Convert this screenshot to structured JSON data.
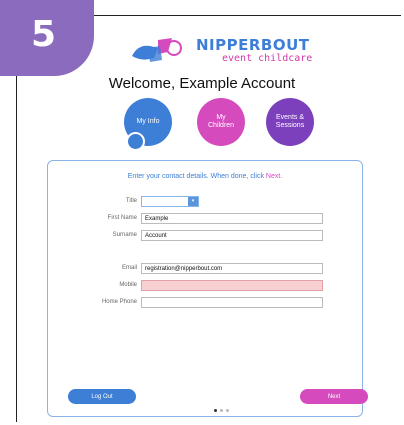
{
  "step_number": "5",
  "brand": {
    "name": "NIPPERBOUT",
    "tagline": "event childcare"
  },
  "welcome": "Welcome, Example Account",
  "nav": [
    {
      "label": "My Info"
    },
    {
      "label": "My Children"
    },
    {
      "label": "Events & Sessions"
    }
  ],
  "form": {
    "instruction_main": "Enter your contact details.  When done, click ",
    "instruction_next": "Next.",
    "title_label": "Title",
    "title_value": "",
    "first_name_label": "First Name",
    "first_name_value": "Example",
    "surname_label": "Surname",
    "surname_value": "Account",
    "email_label": "Email",
    "email_value": "registration@nipperbout.com",
    "mobile_label": "Mobile",
    "mobile_value": "",
    "home_phone_label": "Home Phone",
    "home_phone_value": ""
  },
  "buttons": {
    "logout": "Log Out",
    "next": "Next"
  },
  "colors": {
    "badge": "#8a6bbd",
    "primary_blue": "#3d7ed6",
    "primary_pink": "#d54bbd",
    "purple": "#7c40bd",
    "required_field": "#f8cfd2"
  }
}
